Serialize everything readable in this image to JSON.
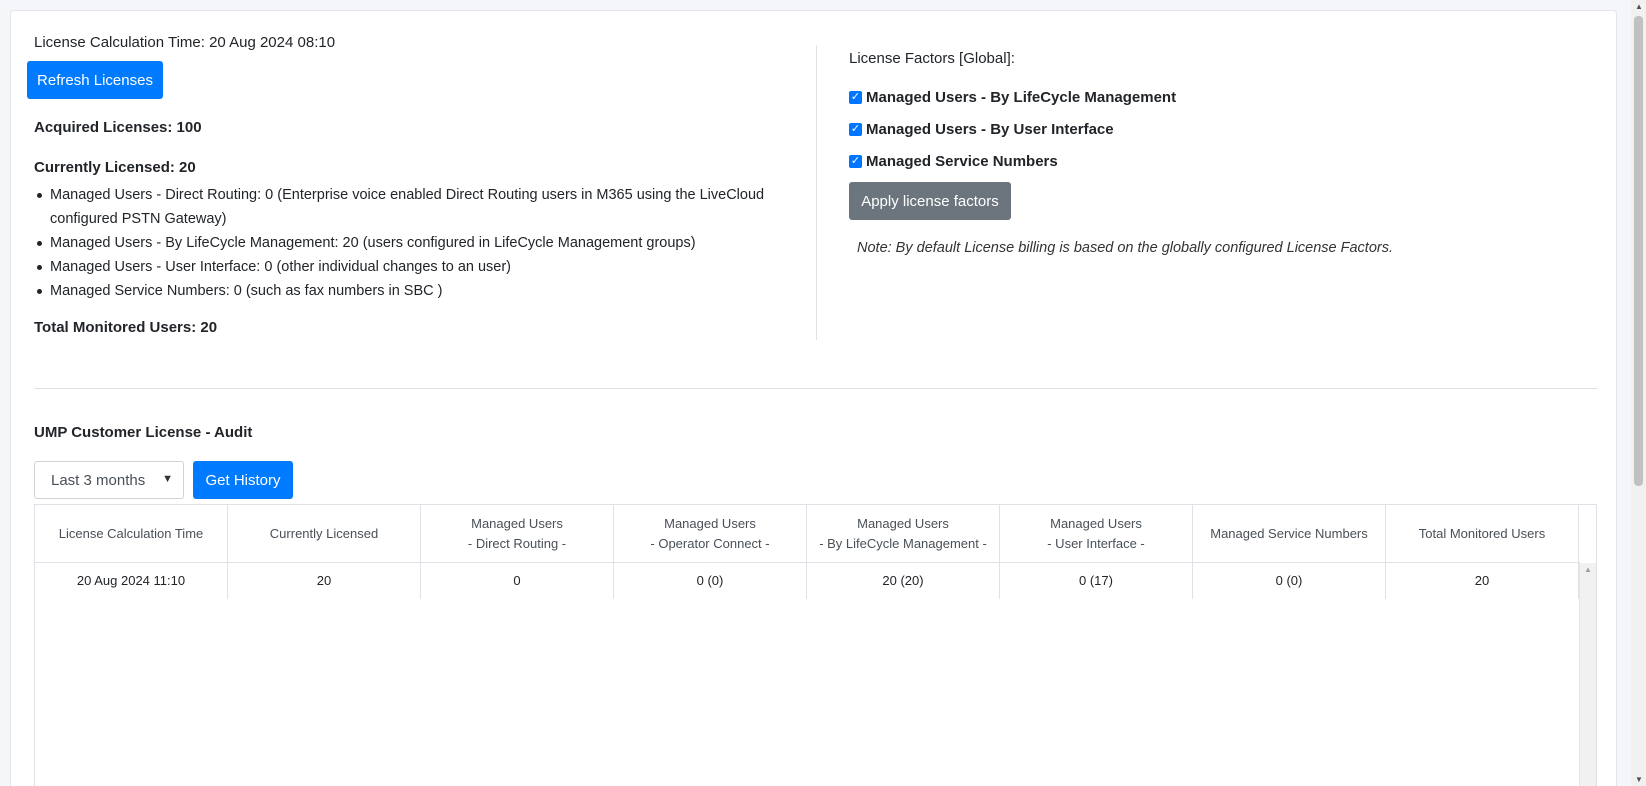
{
  "license_summary": {
    "calc_time_label": "License Calculation Time: 20 Aug 2024 08:10",
    "refresh_button": "Refresh Licenses",
    "acquired": "Acquired Licenses: 100",
    "currently_licensed": "Currently Licensed: 20",
    "usage_items": [
      "Managed Users - Direct Routing: 0 (Enterprise voice enabled Direct Routing users in M365 using the LiveCloud configured PSTN Gateway)",
      "Managed Users - By LifeCycle Management: 20 (users configured in LifeCycle Management groups)",
      "Managed Users - User Interface: 0 (other individual changes to an user)",
      "Managed Service Numbers: 0 (such as fax numbers in SBC )"
    ],
    "total_monitored": "Total Monitored Users: 20"
  },
  "license_factors": {
    "title": "License Factors [Global]:",
    "options": [
      {
        "label": "Managed Users - By LifeCycle Management",
        "checked": true
      },
      {
        "label": "Managed Users - By User Interface",
        "checked": true
      },
      {
        "label": "Managed Service Numbers",
        "checked": true
      }
    ],
    "apply_button": "Apply license factors",
    "note": "Note: By default License billing is based on the globally configured License Factors."
  },
  "audit": {
    "title": "UMP Customer License - Audit",
    "range_selected": "Last 3 months",
    "get_history_button": "Get History",
    "columns": [
      [
        "License Calculation Time"
      ],
      [
        "Currently Licensed"
      ],
      [
        "Managed Users",
        "- Direct Routing -"
      ],
      [
        "Managed Users",
        "- Operator Connect -"
      ],
      [
        "Managed Users",
        "- By LifeCycle Management -"
      ],
      [
        "Managed Users",
        "- User Interface -"
      ],
      [
        "Managed Service Numbers"
      ],
      [
        "Total Monitored Users"
      ]
    ],
    "rows": [
      [
        "20 Aug 2024 11:10",
        "20",
        "0",
        "0 (0)",
        "20 (20)",
        "0 (17)",
        "0 (0)",
        "20"
      ]
    ]
  },
  "colors": {
    "primary": "#007bff",
    "secondary": "#6c757d",
    "checkbox": "#0075ff"
  }
}
